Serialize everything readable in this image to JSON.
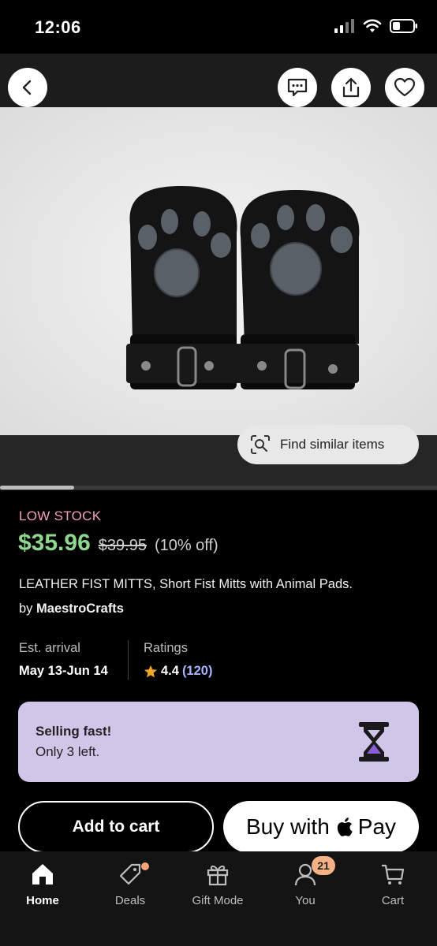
{
  "status": {
    "time": "12:06"
  },
  "header": {
    "back_icon": "chevron-left-icon",
    "message_icon": "message-icon",
    "share_icon": "share-icon",
    "favorite_icon": "heart-icon"
  },
  "image": {
    "find_similar_label": "Find similar items",
    "gallery_position": 0.17
  },
  "product": {
    "stock_label": "LOW STOCK",
    "price": "$35.96",
    "original_price": "$39.95",
    "discount": "(10% off)",
    "title": "LEATHER FIST MITTS, Short Fist Mitts with Animal Pads.",
    "by_prefix": "by",
    "shop": "MaestroCrafts"
  },
  "info": {
    "arrival_label": "Est. arrival",
    "arrival_value": "May 13-Jun 14",
    "ratings_label": "Ratings",
    "rating_value": "4.4",
    "rating_count": "(120)"
  },
  "urgency": {
    "title": "Selling fast!",
    "subtitle": "Only 3 left."
  },
  "actions": {
    "add_to_cart": "Add to cart",
    "buy_with": "Buy with",
    "pay": "Pay"
  },
  "nav": {
    "items": [
      {
        "label": "Home",
        "icon": "home-icon",
        "active": true
      },
      {
        "label": "Deals",
        "icon": "tag-icon"
      },
      {
        "label": "Gift Mode",
        "icon": "gift-icon"
      },
      {
        "label": "You",
        "icon": "user-icon",
        "badge": "21"
      },
      {
        "label": "Cart",
        "icon": "cart-icon"
      }
    ]
  },
  "colors": {
    "price": "#8ed88e",
    "low_stock": "#f4a0b8",
    "card_bg": "#cfc6e8",
    "badge": "#f6b184",
    "rating_count": "#a8b4ff"
  }
}
